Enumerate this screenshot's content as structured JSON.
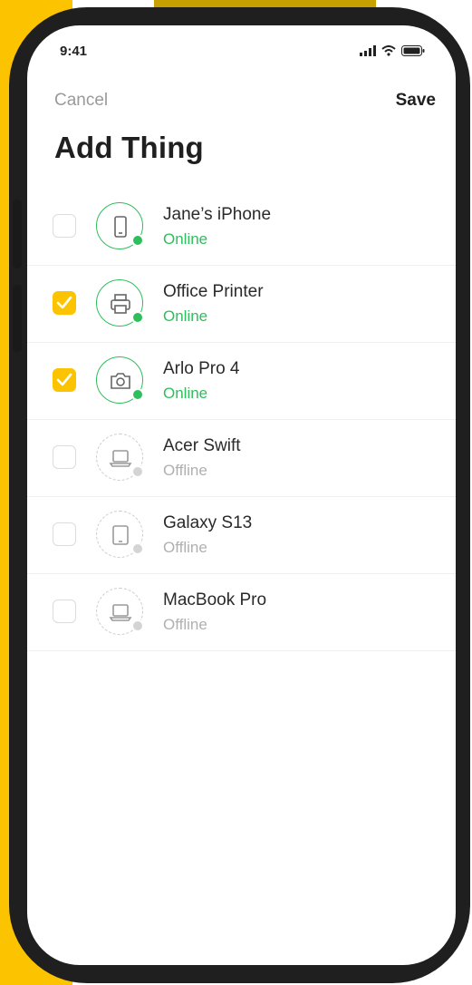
{
  "status_bar": {
    "time": "9:41"
  },
  "nav": {
    "cancel": "Cancel",
    "save": "Save"
  },
  "title": "Add Thing",
  "colors": {
    "accent": "#fcc400",
    "online": "#2fbe5c",
    "offline": "#b0b0b0"
  },
  "devices": [
    {
      "name": "Jane’s iPhone",
      "status": "Online",
      "checked": false,
      "icon": "phone-icon"
    },
    {
      "name": "Office Printer",
      "status": "Online",
      "checked": true,
      "icon": "printer-icon"
    },
    {
      "name": "Arlo Pro 4",
      "status": "Online",
      "checked": true,
      "icon": "camera-icon"
    },
    {
      "name": "Acer Swift",
      "status": "Offline",
      "checked": false,
      "icon": "laptop-icon"
    },
    {
      "name": "Galaxy S13",
      "status": "Offline",
      "checked": false,
      "icon": "tablet-icon"
    },
    {
      "name": "MacBook Pro",
      "status": "Offline",
      "checked": false,
      "icon": "laptop-icon"
    }
  ]
}
